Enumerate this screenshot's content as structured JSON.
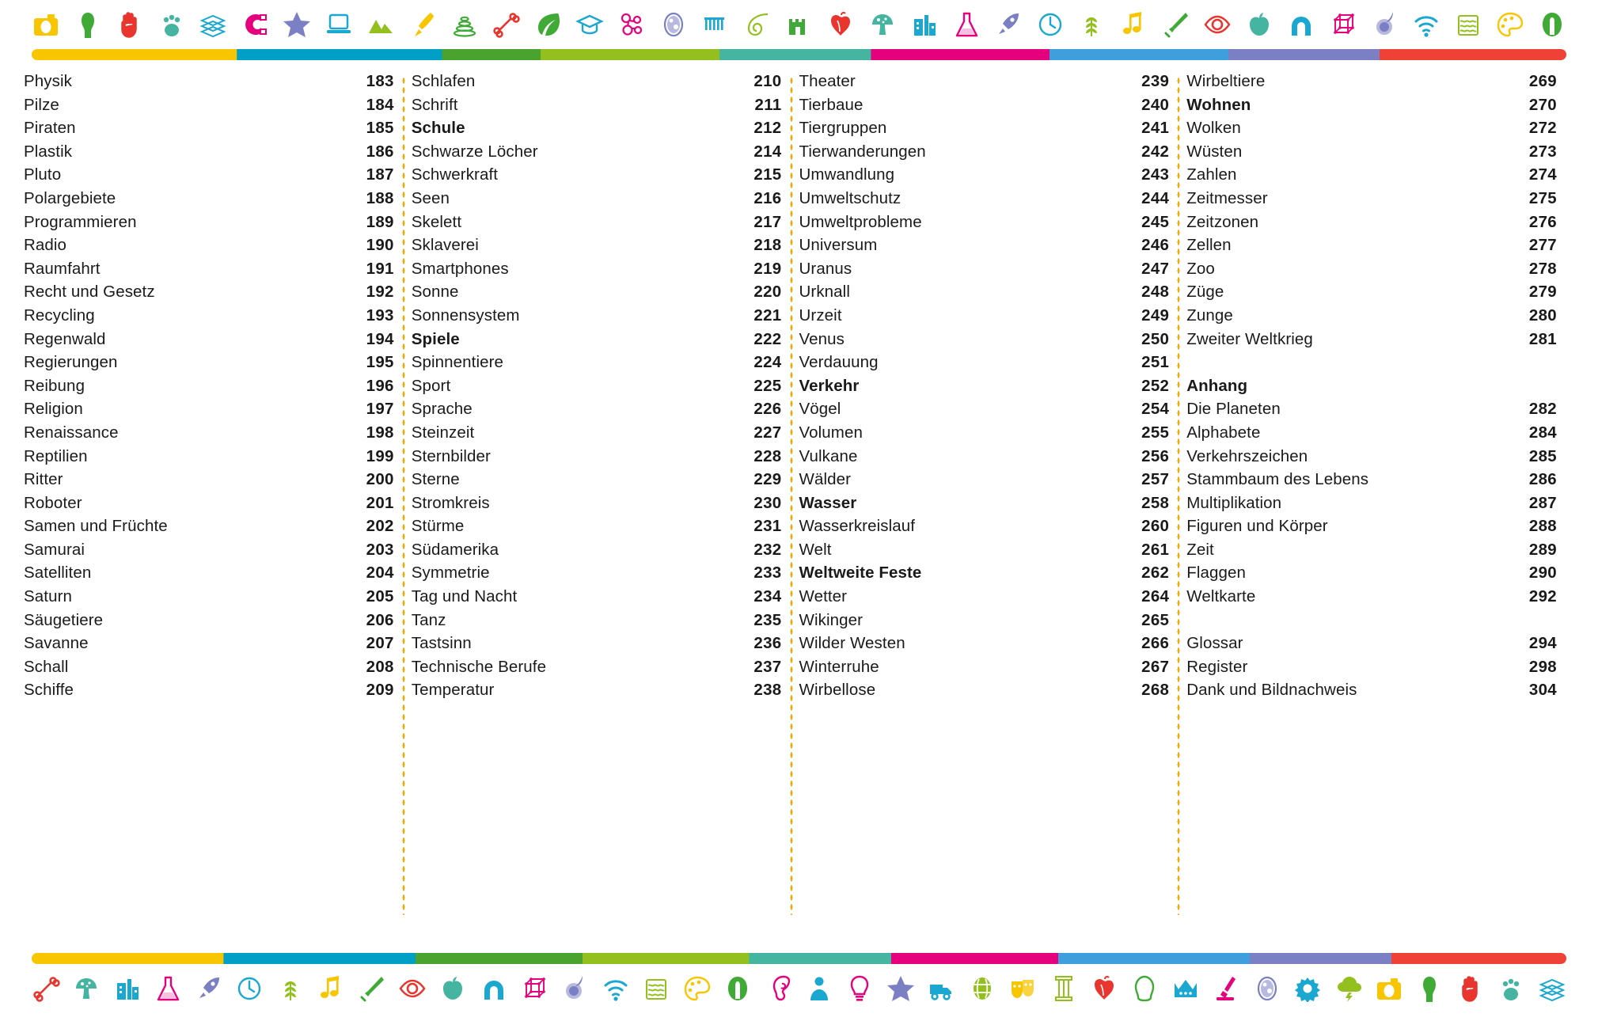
{
  "bands": {
    "top": {
      "icons": [
        {
          "name": "camera-icon",
          "color": "#f7c600"
        },
        {
          "name": "amphora-icon",
          "color": "#3faa35"
        },
        {
          "name": "hand-icon",
          "color": "#e8352e"
        },
        {
          "name": "paw-print-icon",
          "color": "#45b4a0"
        },
        {
          "name": "book-stack-icon",
          "color": "#1aa7d0"
        },
        {
          "name": "magnet-icon",
          "color": "#e5007d"
        },
        {
          "name": "star-icon",
          "color": "#7b7fc4"
        },
        {
          "name": "laptop-icon",
          "color": "#1aa7d0"
        },
        {
          "name": "mountains-icon",
          "color": "#94c01f"
        },
        {
          "name": "paintbrush-icon",
          "color": "#f7c600"
        },
        {
          "name": "stacking-rings-icon",
          "color": "#3faa35"
        },
        {
          "name": "bone-icon",
          "color": "#e8352e"
        },
        {
          "name": "leaf-icon",
          "color": "#3faa35"
        },
        {
          "name": "graduation-cap-icon",
          "color": "#1aa7d0"
        },
        {
          "name": "molecule-icon",
          "color": "#e5007d"
        },
        {
          "name": "cell-icon",
          "color": "#7b7fc4"
        },
        {
          "name": "dna-comb-icon",
          "color": "#1aa7d0"
        },
        {
          "name": "fern-spiral-icon",
          "color": "#94c01f"
        },
        {
          "name": "castle-icon",
          "color": "#3faa35"
        },
        {
          "name": "heart-anatomy-icon",
          "color": "#e8352e"
        },
        {
          "name": "mushroom-icon",
          "color": "#45b4a0"
        },
        {
          "name": "city-buildings-icon",
          "color": "#1aa7d0"
        },
        {
          "name": "flask-icon",
          "color": "#e5007d"
        },
        {
          "name": "rocket-icon",
          "color": "#7b7fc4"
        },
        {
          "name": "clock-icon",
          "color": "#1aa7d0"
        },
        {
          "name": "wheat-icon",
          "color": "#94c01f"
        },
        {
          "name": "music-note-icon",
          "color": "#f7c600"
        },
        {
          "name": "sword-icon",
          "color": "#3faa35"
        },
        {
          "name": "eye-icon",
          "color": "#e8352e"
        },
        {
          "name": "apple-icon",
          "color": "#45b4a0"
        },
        {
          "name": "magnet-horseshoe-icon",
          "color": "#1aa7d0"
        },
        {
          "name": "cube-lattice-icon",
          "color": "#e5007d"
        },
        {
          "name": "comet-icon",
          "color": "#7b7fc4"
        },
        {
          "name": "wifi-icon",
          "color": "#1aa7d0"
        },
        {
          "name": "water-waves-icon",
          "color": "#94c01f"
        },
        {
          "name": "paint-palette-icon",
          "color": "#f7c600"
        },
        {
          "name": "helmet-icon",
          "color": "#3faa35"
        }
      ],
      "rule_segments": [
        {
          "color": "#f7c600",
          "flex": 8
        },
        {
          "color": "#00a0c6",
          "flex": 8
        },
        {
          "color": "#4ba32f",
          "flex": 4
        },
        {
          "color": "#94c01f",
          "flex": 7
        },
        {
          "color": "#45b4a0",
          "flex": 6
        },
        {
          "color": "#e5007d",
          "flex": 7
        },
        {
          "color": "#3f9fdc",
          "flex": 7
        },
        {
          "color": "#7b7fc4",
          "flex": 6
        },
        {
          "color": "#ef4136",
          "flex": 7
        }
      ]
    },
    "bottom": {
      "icons": [
        {
          "name": "bone-icon",
          "color": "#e8352e"
        },
        {
          "name": "mushroom-icon",
          "color": "#45b4a0"
        },
        {
          "name": "city-buildings-icon",
          "color": "#1aa7d0"
        },
        {
          "name": "flask-icon",
          "color": "#e5007d"
        },
        {
          "name": "rocket-icon",
          "color": "#7b7fc4"
        },
        {
          "name": "clock-icon",
          "color": "#1aa7d0"
        },
        {
          "name": "wheat-icon",
          "color": "#94c01f"
        },
        {
          "name": "music-note-icon",
          "color": "#f7c600"
        },
        {
          "name": "sword-icon",
          "color": "#3faa35"
        },
        {
          "name": "eye-icon",
          "color": "#e8352e"
        },
        {
          "name": "apple-icon",
          "color": "#45b4a0"
        },
        {
          "name": "magnet-horseshoe-icon",
          "color": "#1aa7d0"
        },
        {
          "name": "cube-lattice-icon",
          "color": "#e5007d"
        },
        {
          "name": "comet-icon",
          "color": "#7b7fc4"
        },
        {
          "name": "wifi-icon",
          "color": "#1aa7d0"
        },
        {
          "name": "water-waves-icon",
          "color": "#94c01f"
        },
        {
          "name": "paint-palette-icon",
          "color": "#f7c600"
        },
        {
          "name": "helmet-icon",
          "color": "#3faa35"
        },
        {
          "name": "ear-icon",
          "color": "#e5007d"
        },
        {
          "name": "person-icon",
          "color": "#1aa7d0"
        },
        {
          "name": "lightbulb-icon",
          "color": "#e5007d"
        },
        {
          "name": "star-icon",
          "color": "#7b7fc4"
        },
        {
          "name": "truck-icon",
          "color": "#1aa7d0"
        },
        {
          "name": "globe-icon",
          "color": "#94c01f"
        },
        {
          "name": "theatre-masks-icon",
          "color": "#f7c600"
        },
        {
          "name": "column-icon",
          "color": "#94c01f"
        },
        {
          "name": "heart-anatomy-icon",
          "color": "#e8352e"
        },
        {
          "name": "footprint-icon",
          "color": "#3faa35"
        },
        {
          "name": "crown-icon",
          "color": "#1aa7d0"
        },
        {
          "name": "microscope-icon",
          "color": "#e5007d"
        },
        {
          "name": "cell-icon",
          "color": "#7b7fc4"
        },
        {
          "name": "gear-icon",
          "color": "#1aa7d0"
        },
        {
          "name": "storm-cloud-icon",
          "color": "#94c01f"
        },
        {
          "name": "camera-icon",
          "color": "#f7c600"
        },
        {
          "name": "amphora-icon",
          "color": "#3faa35"
        },
        {
          "name": "hand-icon",
          "color": "#e8352e"
        },
        {
          "name": "paw-print-icon",
          "color": "#45b4a0"
        },
        {
          "name": "book-stack-icon",
          "color": "#1aa7d0"
        }
      ],
      "rule_segments": [
        {
          "color": "#f7c600",
          "flex": 8
        },
        {
          "color": "#00a0c6",
          "flex": 8
        },
        {
          "color": "#4ba32f",
          "flex": 7
        },
        {
          "color": "#94c01f",
          "flex": 7
        },
        {
          "color": "#45b4a0",
          "flex": 6
        },
        {
          "color": "#e5007d",
          "flex": 7
        },
        {
          "color": "#3f9fdc",
          "flex": 8
        },
        {
          "color": "#7b7fc4",
          "flex": 6
        },
        {
          "color": "#ef4136",
          "flex": 7
        }
      ]
    }
  },
  "columns": [
    {
      "id": "column-1",
      "entries": [
        {
          "label": "Physik",
          "page": "183",
          "bold": false
        },
        {
          "label": "Pilze",
          "page": "184",
          "bold": false
        },
        {
          "label": "Piraten",
          "page": "185",
          "bold": false
        },
        {
          "label": "Plastik",
          "page": "186",
          "bold": false
        },
        {
          "label": "Pluto",
          "page": "187",
          "bold": false
        },
        {
          "label": "Polargebiete",
          "page": "188",
          "bold": false
        },
        {
          "label": "Programmieren",
          "page": "189",
          "bold": false
        },
        {
          "label": "Radio",
          "page": "190",
          "bold": false
        },
        {
          "label": "Raumfahrt",
          "page": "191",
          "bold": false
        },
        {
          "label": "Recht und Gesetz",
          "page": "192",
          "bold": false
        },
        {
          "label": "Recycling",
          "page": "193",
          "bold": false
        },
        {
          "label": "Regenwald",
          "page": "194",
          "bold": false
        },
        {
          "label": "Regierungen",
          "page": "195",
          "bold": false
        },
        {
          "label": "Reibung",
          "page": "196",
          "bold": false
        },
        {
          "label": "Religion",
          "page": "197",
          "bold": false
        },
        {
          "label": "Renaissance",
          "page": "198",
          "bold": false
        },
        {
          "label": "Reptilien",
          "page": "199",
          "bold": false
        },
        {
          "label": "Ritter",
          "page": "200",
          "bold": false
        },
        {
          "label": "Roboter",
          "page": "201",
          "bold": false
        },
        {
          "label": "Samen und Früchte",
          "page": "202",
          "bold": false
        },
        {
          "label": "Samurai",
          "page": "203",
          "bold": false
        },
        {
          "label": "Satelliten",
          "page": "204",
          "bold": false
        },
        {
          "label": "Saturn",
          "page": "205",
          "bold": false
        },
        {
          "label": "Säugetiere",
          "page": "206",
          "bold": false
        },
        {
          "label": "Savanne",
          "page": "207",
          "bold": false
        },
        {
          "label": "Schall",
          "page": "208",
          "bold": false
        },
        {
          "label": "Schiffe",
          "page": "209",
          "bold": false
        }
      ]
    },
    {
      "id": "column-2",
      "entries": [
        {
          "label": "Schlafen",
          "page": "210",
          "bold": false
        },
        {
          "label": "Schrift",
          "page": "211",
          "bold": false
        },
        {
          "label": "Schule",
          "page": "212",
          "bold": true
        },
        {
          "label": "Schwarze Löcher",
          "page": "214",
          "bold": false
        },
        {
          "label": "Schwerkraft",
          "page": "215",
          "bold": false
        },
        {
          "label": "Seen",
          "page": "216",
          "bold": false
        },
        {
          "label": "Skelett",
          "page": "217",
          "bold": false
        },
        {
          "label": "Sklaverei",
          "page": "218",
          "bold": false
        },
        {
          "label": "Smartphones",
          "page": "219",
          "bold": false
        },
        {
          "label": "Sonne",
          "page": "220",
          "bold": false
        },
        {
          "label": "Sonnensystem",
          "page": "221",
          "bold": false
        },
        {
          "label": "Spiele",
          "page": "222",
          "bold": true
        },
        {
          "label": "Spinnentiere",
          "page": "224",
          "bold": false
        },
        {
          "label": "Sport",
          "page": "225",
          "bold": false
        },
        {
          "label": "Sprache",
          "page": "226",
          "bold": false
        },
        {
          "label": "Steinzeit",
          "page": "227",
          "bold": false
        },
        {
          "label": "Sternbilder",
          "page": "228",
          "bold": false
        },
        {
          "label": "Sterne",
          "page": "229",
          "bold": false
        },
        {
          "label": "Stromkreis",
          "page": "230",
          "bold": false
        },
        {
          "label": "Stürme",
          "page": "231",
          "bold": false
        },
        {
          "label": "Südamerika",
          "page": "232",
          "bold": false
        },
        {
          "label": "Symmetrie",
          "page": "233",
          "bold": false
        },
        {
          "label": "Tag und Nacht",
          "page": "234",
          "bold": false
        },
        {
          "label": "Tanz",
          "page": "235",
          "bold": false
        },
        {
          "label": "Tastsinn",
          "page": "236",
          "bold": false
        },
        {
          "label": "Technische Berufe",
          "page": "237",
          "bold": false
        },
        {
          "label": "Temperatur",
          "page": "238",
          "bold": false
        }
      ]
    },
    {
      "id": "column-3",
      "entries": [
        {
          "label": "Theater",
          "page": "239",
          "bold": false
        },
        {
          "label": "Tierbaue",
          "page": "240",
          "bold": false
        },
        {
          "label": "Tiergruppen",
          "page": "241",
          "bold": false
        },
        {
          "label": "Tierwanderungen",
          "page": "242",
          "bold": false
        },
        {
          "label": "Umwandlung",
          "page": "243",
          "bold": false
        },
        {
          "label": "Umweltschutz",
          "page": "244",
          "bold": false
        },
        {
          "label": "Umweltprobleme",
          "page": "245",
          "bold": false
        },
        {
          "label": "Universum",
          "page": "246",
          "bold": false
        },
        {
          "label": "Uranus",
          "page": "247",
          "bold": false
        },
        {
          "label": "Urknall",
          "page": "248",
          "bold": false
        },
        {
          "label": "Urzeit",
          "page": "249",
          "bold": false
        },
        {
          "label": "Venus",
          "page": "250",
          "bold": false
        },
        {
          "label": "Verdauung",
          "page": "251",
          "bold": false
        },
        {
          "label": "Verkehr",
          "page": "252",
          "bold": true
        },
        {
          "label": "Vögel",
          "page": "254",
          "bold": false
        },
        {
          "label": "Volumen",
          "page": "255",
          "bold": false
        },
        {
          "label": "Vulkane",
          "page": "256",
          "bold": false
        },
        {
          "label": "Wälder",
          "page": "257",
          "bold": false
        },
        {
          "label": "Wasser",
          "page": "258",
          "bold": true
        },
        {
          "label": "Wasserkreislauf",
          "page": "260",
          "bold": false
        },
        {
          "label": "Welt",
          "page": "261",
          "bold": false
        },
        {
          "label": "Weltweite Feste",
          "page": "262",
          "bold": true
        },
        {
          "label": "Wetter",
          "page": "264",
          "bold": false
        },
        {
          "label": "Wikinger",
          "page": "265",
          "bold": false
        },
        {
          "label": "Wilder Westen",
          "page": "266",
          "bold": false
        },
        {
          "label": "Winterruhe",
          "page": "267",
          "bold": false
        },
        {
          "label": "Wirbellose",
          "page": "268",
          "bold": false
        }
      ]
    },
    {
      "id": "column-4",
      "entries": [
        {
          "label": "Wirbeltiere",
          "page": "269",
          "bold": false
        },
        {
          "label": "Wohnen",
          "page": "270",
          "bold": true
        },
        {
          "label": "Wolken",
          "page": "272",
          "bold": false
        },
        {
          "label": "Wüsten",
          "page": "273",
          "bold": false
        },
        {
          "label": "Zahlen",
          "page": "274",
          "bold": false
        },
        {
          "label": "Zeitmesser",
          "page": "275",
          "bold": false
        },
        {
          "label": "Zeitzonen",
          "page": "276",
          "bold": false
        },
        {
          "label": "Zellen",
          "page": "277",
          "bold": false
        },
        {
          "label": "Zoo",
          "page": "278",
          "bold": false
        },
        {
          "label": "Züge",
          "page": "279",
          "bold": false
        },
        {
          "label": "Zunge",
          "page": "280",
          "bold": false
        },
        {
          "label": "Zweiter Weltkrieg",
          "page": "281",
          "bold": false
        },
        {
          "label": "",
          "page": "",
          "bold": false,
          "spacer": true
        },
        {
          "label": "Anhang",
          "page": "",
          "bold": true,
          "heading": true
        },
        {
          "label": "Die Planeten",
          "page": "282",
          "bold": false
        },
        {
          "label": "Alphabete",
          "page": "284",
          "bold": false
        },
        {
          "label": "Verkehrszeichen",
          "page": "285",
          "bold": false
        },
        {
          "label": "Stammbaum des Lebens",
          "page": "286",
          "bold": false
        },
        {
          "label": "Multiplikation",
          "page": "287",
          "bold": false
        },
        {
          "label": "Figuren und Körper",
          "page": "288",
          "bold": false
        },
        {
          "label": "Zeit",
          "page": "289",
          "bold": false
        },
        {
          "label": "Flaggen",
          "page": "290",
          "bold": false
        },
        {
          "label": "Weltkarte",
          "page": "292",
          "bold": false
        },
        {
          "label": "",
          "page": "",
          "bold": false,
          "spacer": true
        },
        {
          "label": "Glossar",
          "page": "294",
          "bold": false
        },
        {
          "label": "Register",
          "page": "298",
          "bold": false
        },
        {
          "label": "Dank und Bildnachweis",
          "page": "304",
          "bold": false
        }
      ]
    }
  ],
  "colors": {
    "divider_dots": "#f5a800",
    "text": "#1a1a1a"
  }
}
